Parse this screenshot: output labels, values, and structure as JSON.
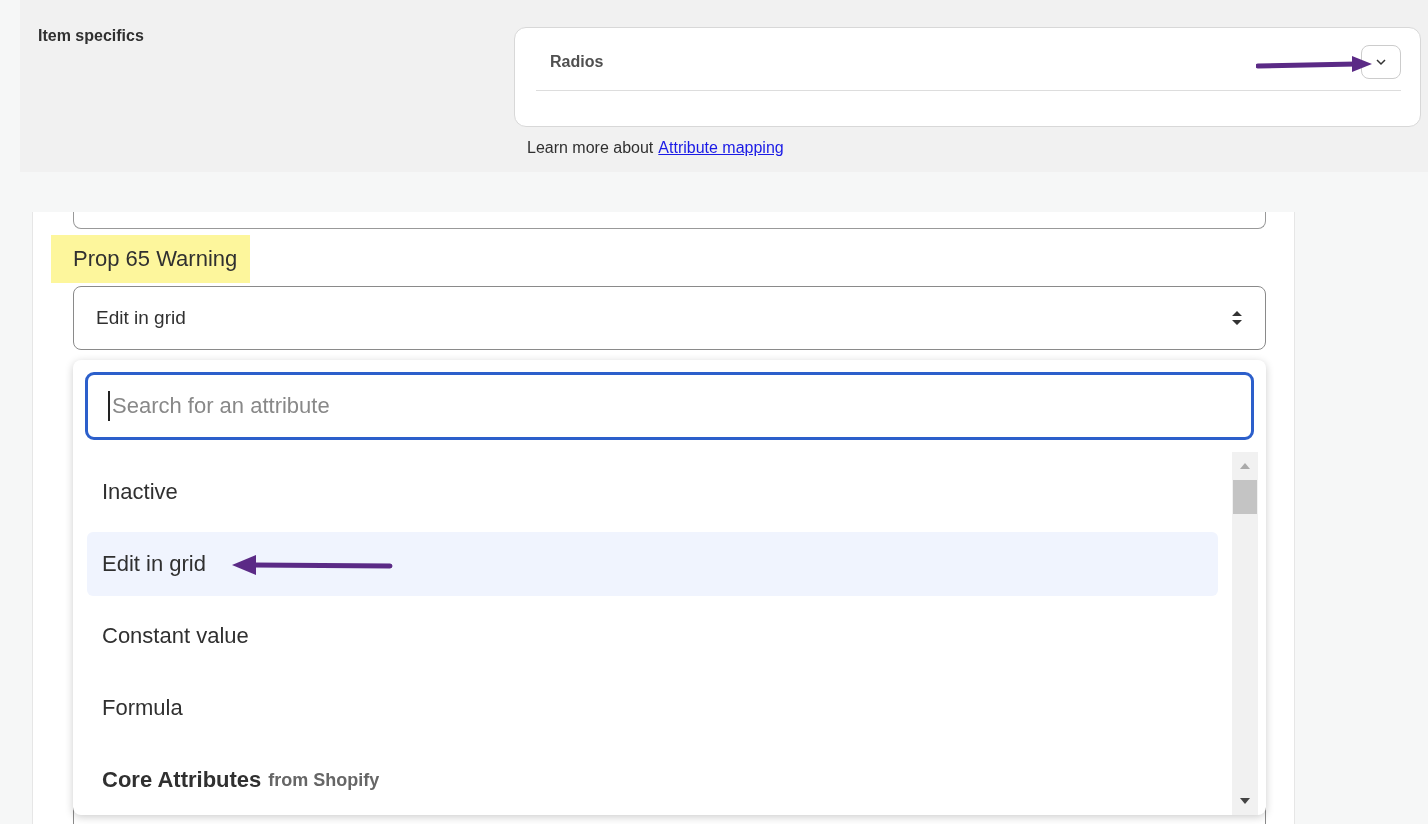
{
  "item_specifics": {
    "label": "Item specifics",
    "select": {
      "value": "Radios"
    },
    "help": {
      "text": "Learn more about",
      "link": "Attribute mapping"
    }
  },
  "field": {
    "label": "Prop 65 Warning",
    "highlighted": true,
    "select": {
      "value": "Edit in grid"
    }
  },
  "dropdown": {
    "search": {
      "placeholder": "Search for an attribute"
    },
    "options": [
      {
        "kind": "option",
        "label": "Inactive",
        "selected": false
      },
      {
        "kind": "option",
        "label": "Edit in grid",
        "selected": true
      },
      {
        "kind": "option",
        "label": "Constant value",
        "selected": false
      },
      {
        "kind": "option",
        "label": "Formula",
        "selected": false
      },
      {
        "kind": "header",
        "label": "Core Attributes",
        "sub": "from Shopify"
      }
    ]
  }
}
